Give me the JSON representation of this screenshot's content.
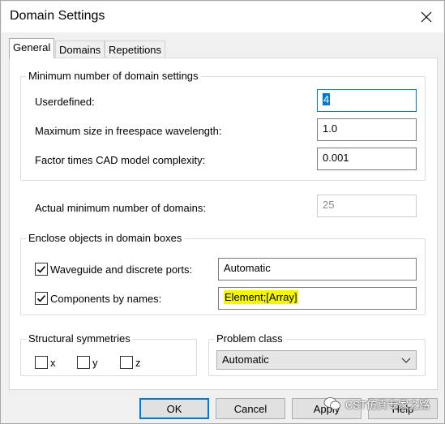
{
  "window": {
    "title": "Domain Settings"
  },
  "tabs": [
    {
      "label": "General",
      "active": true
    },
    {
      "label": "Domains",
      "active": false
    },
    {
      "label": "Repetitions",
      "active": false
    }
  ],
  "min_domain_group": {
    "legend": "Minimum number of domain settings",
    "userdefined": {
      "label": "Userdefined:",
      "value": "4"
    },
    "max_size": {
      "label": "Maximum size in freespace wavelength:",
      "value": "1.0"
    },
    "factor": {
      "label": "Factor times CAD model complexity:",
      "value": "0.001"
    }
  },
  "actual_min": {
    "label": "Actual minimum number of domains:",
    "value": "25"
  },
  "enclose_group": {
    "legend": "Enclose objects in domain boxes",
    "waveguide": {
      "label": "Waveguide and discrete ports:",
      "checked": true,
      "value": "Automatic"
    },
    "components": {
      "label": "Components by names:",
      "checked": true,
      "value": "Element;[Array]"
    }
  },
  "symmetries": {
    "legend": "Structural symmetries",
    "x": "x",
    "y": "y",
    "z": "z"
  },
  "problem_class": {
    "legend": "Problem class",
    "selected": "Automatic"
  },
  "buttons": {
    "ok": "OK",
    "cancel": "Cancel",
    "apply": "Apply",
    "help": "Help"
  },
  "watermark": {
    "text": "CST仿真专家之路"
  },
  "colors": {
    "accent": "#0078d7",
    "highlight": "#f6f600"
  }
}
